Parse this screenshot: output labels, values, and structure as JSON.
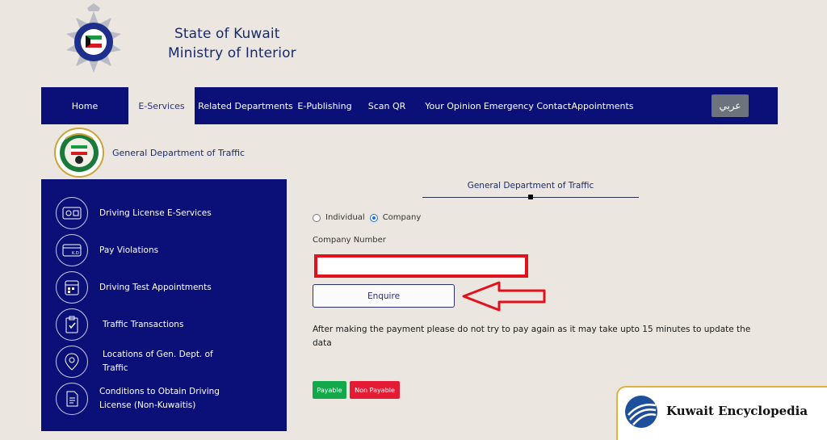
{
  "header": {
    "line1": "State of Kuwait",
    "line2": "Ministry of Interior",
    "logo_icon": "kuwait-police-star-icon"
  },
  "nav": {
    "items": [
      "Home",
      "E-Services",
      "Related Departments",
      "E-Publishing",
      "Scan QR",
      "Your Opinion",
      "Emergency Contact",
      "Appointments"
    ],
    "active": "E-Services",
    "lang_button": "عربي"
  },
  "department": {
    "name": "General Department of Traffic",
    "logo_icon": "traffic-department-emblem-icon"
  },
  "sidebar": {
    "items": [
      {
        "label": "Driving License E-Services",
        "icon": "license-card-icon"
      },
      {
        "label": "Pay Violations",
        "icon": "kd-card-icon"
      },
      {
        "label": "Driving Test Appointments",
        "icon": "calendar-icon"
      },
      {
        "label": "Traffic Transactions",
        "icon": "clipboard-check-icon"
      },
      {
        "label": "Locations of Gen. Dept. of Traffic",
        "icon": "map-pin-icon"
      },
      {
        "label": "Conditions to Obtain Driving License (Non-Kuwaitis)",
        "icon": "document-icon"
      }
    ]
  },
  "form": {
    "title": "General Department of Traffic",
    "radio_individual": "Individual",
    "radio_company": "Company",
    "selected": "Company",
    "company_number_label": "Company Number",
    "company_number_value": "",
    "enquire_label": "Enquire",
    "notice": "After making the payment please do not try to pay again as it may take upto 15 minutes to update the data",
    "payable_label": "Payable",
    "non_payable_label": "Non Payable"
  },
  "colors": {
    "navy": "#0b1079",
    "highlight_red": "#e3111b",
    "payable_green": "#13a84a",
    "non_payable_red": "#e31b33"
  },
  "watermark": {
    "text": "Kuwait Encyclopedia"
  }
}
